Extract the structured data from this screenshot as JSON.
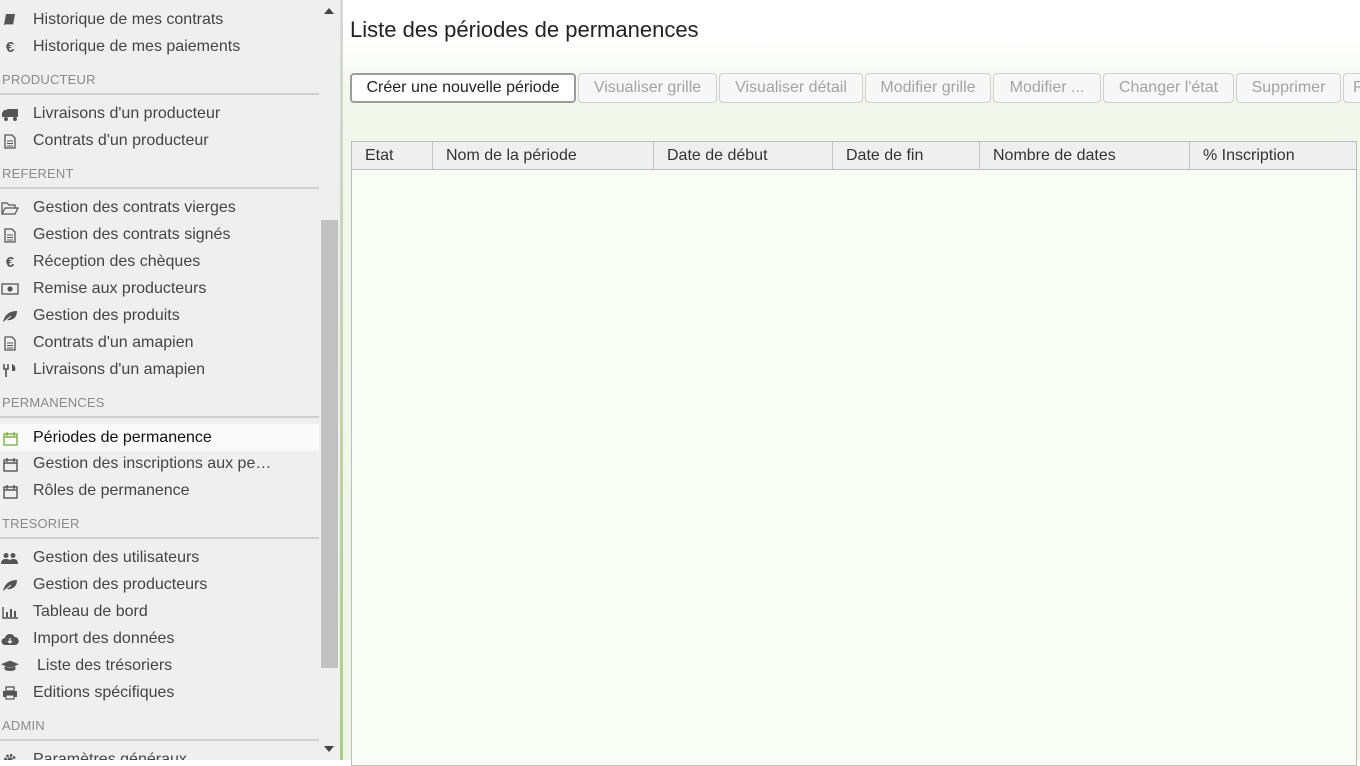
{
  "sidebar": {
    "items_top": [
      {
        "label": "Historique de mes contrats",
        "icon": "book-icon"
      },
      {
        "label": "Historique de mes paiements",
        "icon": "euro-icon"
      }
    ],
    "sections": [
      {
        "title": "PRODUCTEUR",
        "items": [
          {
            "label": "Livraisons d'un producteur",
            "icon": "truck-icon"
          },
          {
            "label": "Contrats d'un producteur",
            "icon": "document-icon"
          }
        ]
      },
      {
        "title": "REFERENT",
        "items": [
          {
            "label": "Gestion des contrats vierges",
            "icon": "folder-open-icon"
          },
          {
            "label": "Gestion des contrats signés",
            "icon": "document-icon"
          },
          {
            "label": "Réception des chèques",
            "icon": "euro-icon"
          },
          {
            "label": "Remise aux producteurs",
            "icon": "money-icon"
          },
          {
            "label": "Gestion des produits",
            "icon": "leaf-icon"
          },
          {
            "label": "Contrats d'un amapien",
            "icon": "document-icon"
          },
          {
            "label": "Livraisons d'un amapien",
            "icon": "cutlery-icon"
          }
        ]
      },
      {
        "title": "PERMANENCES",
        "items": [
          {
            "label": "Périodes de permanence",
            "icon": "calendar-icon",
            "active": true
          },
          {
            "label": "Gestion des inscriptions aux pe…",
            "icon": "calendar-icon"
          },
          {
            "label": "Rôles de permanence",
            "icon": "calendar-icon"
          }
        ]
      },
      {
        "title": "TRESORIER",
        "items": [
          {
            "label": "Gestion des utilisateurs",
            "icon": "users-icon"
          },
          {
            "label": "Gestion des producteurs",
            "icon": "leaf-icon"
          },
          {
            "label": "Tableau de bord",
            "icon": "bar-chart-icon"
          },
          {
            "label": "Import des données",
            "icon": "cloud-download-icon"
          },
          {
            "label": "Liste des trésoriers",
            "icon": "graduation-cap-icon"
          },
          {
            "label": "Editions spécifiques",
            "icon": "print-icon"
          }
        ]
      },
      {
        "title": "ADMIN",
        "items": [
          {
            "label": "Paramètres généraux",
            "icon": "gear-icon"
          }
        ]
      }
    ]
  },
  "main": {
    "title": "Liste des périodes de permanences",
    "toolbar": [
      {
        "label": "Créer une nouvelle période",
        "enabled": true
      },
      {
        "label": "Visualiser grille",
        "enabled": false
      },
      {
        "label": "Visualiser détail",
        "enabled": false
      },
      {
        "label": "Modifier grille",
        "enabled": false
      },
      {
        "label": "Modifier ...",
        "enabled": false
      },
      {
        "label": "Changer l'état",
        "enabled": false
      },
      {
        "label": "Supprimer",
        "enabled": false
      },
      {
        "label": "R",
        "enabled": false
      }
    ],
    "grid": {
      "columns": [
        "Etat",
        "Nom de la période",
        "Date de début",
        "Date de fin",
        "Nombre de dates",
        "% Inscription"
      ],
      "rows": []
    }
  },
  "colors": {
    "accent_green": "#a8cf86",
    "active_icon": "#7cb342"
  }
}
